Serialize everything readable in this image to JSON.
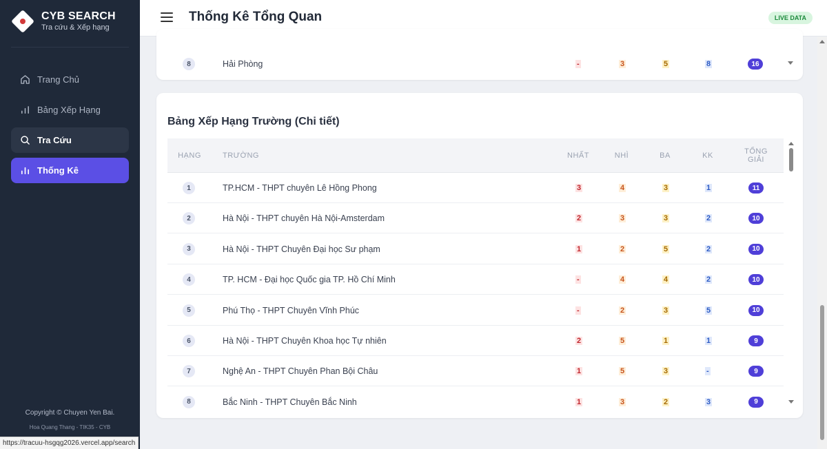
{
  "brand": {
    "title": "CYB SEARCH",
    "subtitle": "Tra cứu & Xếp hạng"
  },
  "nav": [
    {
      "label": "Trang Chủ",
      "icon": "home-icon"
    },
    {
      "label": "Bảng Xếp Hạng",
      "icon": "bar-chart-icon"
    },
    {
      "label": "Tra Cứu",
      "icon": "search-icon"
    },
    {
      "label": "Thống Kê",
      "icon": "stats-icon"
    }
  ],
  "footer": {
    "copyright": "Copyright © Chuyen Yen Bai.",
    "credit": "Hoa Quang Thang - TIK35 - CYB"
  },
  "status_url": "https://tracuu-hsgqg2026.vercel.app/search",
  "header": {
    "title": "Thống Kê Tổng Quan",
    "badge": "LIVE DATA"
  },
  "province_row": {
    "rank": "8",
    "name": "Hải Phòng",
    "nhat": "-",
    "nhi": "3",
    "ba": "5",
    "kk": "8",
    "total": "16"
  },
  "school_table": {
    "title": "Bảng Xếp Hạng Trường (Chi tiết)",
    "headers": {
      "rank": "HẠNG",
      "school": "TRƯỜNG",
      "nhat": "NHẤT",
      "nhi": "NHÌ",
      "ba": "BA",
      "kk": "KK",
      "total": "TỔNG GIẢI"
    },
    "rows": [
      {
        "rank": "1",
        "name": "TP.HCM - THPT chuyên Lê Hồng Phong",
        "nhat": "3",
        "nhi": "4",
        "ba": "3",
        "kk": "1",
        "total": "11"
      },
      {
        "rank": "2",
        "name": "Hà Nội - THPT chuyên Hà Nội-Amsterdam",
        "nhat": "2",
        "nhi": "3",
        "ba": "3",
        "kk": "2",
        "total": "10"
      },
      {
        "rank": "3",
        "name": "Hà Nội - THPT Chuyên Đại học Sư phạm",
        "nhat": "1",
        "nhi": "2",
        "ba": "5",
        "kk": "2",
        "total": "10"
      },
      {
        "rank": "4",
        "name": "TP. HCM - Đại học Quốc gia TP. Hồ Chí Minh",
        "nhat": "-",
        "nhi": "4",
        "ba": "4",
        "kk": "2",
        "total": "10"
      },
      {
        "rank": "5",
        "name": "Phú Thọ - THPT Chuyên Vĩnh Phúc",
        "nhat": "-",
        "nhi": "2",
        "ba": "3",
        "kk": "5",
        "total": "10"
      },
      {
        "rank": "6",
        "name": "Hà Nội - THPT Chuyên Khoa học Tự nhiên",
        "nhat": "2",
        "nhi": "5",
        "ba": "1",
        "kk": "1",
        "total": "9"
      },
      {
        "rank": "7",
        "name": "Nghệ An - THPT Chuyên Phan Bội Châu",
        "nhat": "1",
        "nhi": "5",
        "ba": "3",
        "kk": "-",
        "total": "9"
      },
      {
        "rank": "8",
        "name": "Bắc Ninh - THPT Chuyên Bắc Ninh",
        "nhat": "1",
        "nhi": "3",
        "ba": "2",
        "kk": "3",
        "total": "9"
      }
    ]
  },
  "colors": {
    "sidebar": "#1f2939",
    "accent": "#5b4fe5",
    "total_badge": "#4f3fd8",
    "live_bg": "#d8f5df",
    "live_text": "#1c8a3c"
  }
}
